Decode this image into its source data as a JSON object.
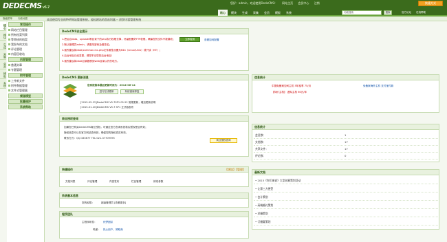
{
  "header": {
    "logo_text": "DEDECMS",
    "logo_version": "v5.7",
    "top_links": [
      "您好：admin，欢迎使用DedeCMS！",
      "网站主页",
      "会员中心",
      "注销"
    ],
    "shortcut_label": "快捷方式",
    "nav": [
      "核心",
      "模块",
      "生成",
      "采集",
      "会员",
      "模板",
      "系统"
    ],
    "nav_active": "核心",
    "search_placeholder": "功能搜索",
    "search_button": "搜索",
    "right_links": [
      "官方论坛",
      "在线帮助"
    ]
  },
  "subbar": {
    "left": "隐藏菜单",
    "middle": "功能地图"
  },
  "welcome_text": "欢迎使用专业的PHP网站管理系统，轻松建站的首选利器 -- 织梦内容管理系统",
  "vtabs": [
    "核心",
    "模块",
    "生成",
    "采集",
    "会员",
    "模板",
    "系统"
  ],
  "sidebar": {
    "sections": [
      {
        "title": "常用操作",
        "items": [
          "网站栏目管理",
          "所有档案列表",
          "等审核的档案",
          "我发布的文档",
          "评论管理",
          "内容回收站"
        ]
      },
      {
        "title": "内容管理",
        "items": [
          "普通文章",
          "专题管理"
        ]
      },
      {
        "title": "附件管理",
        "items": [
          "上传新文件",
          "附件数据管理",
          "文件式管理器"
        ]
      },
      {
        "title": "频道模型",
        "items": []
      },
      {
        "title": "批量维护",
        "items": []
      },
      {
        "title": "系统帮助",
        "items": []
      }
    ]
  },
  "security": {
    "title": "DedeCMS安全提示",
    "lines": [
      "1.把后台data、uploads等目录下的php执行权限去掉，尽量配置好FTP权限，确保您的文件不被篡改；",
      "2.默认管理员admin，请更改密码及登录名；",
      "3.强烈建议将data/common.inc.php文件属性设置为644（Linux/Unix）或只读（NT）；",
      "4.后台地址已经变更，请您牢记您的后台地址！",
      "5.强烈建议将data目录搬移到web目录以外的地方。"
    ],
    "button": "立即检测",
    "link": "查看如何配置"
  },
  "update": {
    "title": "DedeCMS 更新消息",
    "version_text": "您系统版本最后更新时间为：2014-06-14",
    "btn_check": "进行在线更新",
    "btn_log": "系统错误修复",
    "news_lines": [
      "[2015-05-22]DedeCMS V5.7SP1 05-22 常规更新，增加更新说明",
      "[2015-01-20]DedeCMS V5.7 SP1 正式版发布"
    ]
  },
  "commercial": {
    "title": "商业授权查询",
    "lines": [
      "如果您已购买DedeCMS商业授权，可通过官方查询系统核实授权是否有效；",
      "授权信息可以在官方网站查询到，确保您的授权真实有效。",
      "联系方式：QQ:163677 TEL:021-37709595"
    ],
    "button": "商业授权查询"
  },
  "shortcut": {
    "title": "快捷操作",
    "right": "【增加】【管理】",
    "items": [
      "文档列表",
      "评论管理",
      "内容发布",
      "栏目管理",
      "修改系统参数",
      "修改参数"
    ]
  },
  "sysinfo": {
    "title": "系统基本信息",
    "label": "您的权限：",
    "value": "超级管理员 [查看更多]"
  },
  "team": {
    "title": "程序团队",
    "rows": [
      {
        "label": "主程序研发：",
        "value": "织梦团队"
      },
      {
        "label": "鸣谢：",
        "value": "热心用户、赞助商"
      }
    ]
  },
  "messages": {
    "title": "信息统计",
    "ad_row1_left": "中国免备案空间主机 5年独享 75/月",
    "ad_row1_right": "免备案海外主机 支付宝付款",
    "ad_row2_left": "【特价主机】 虚拟主机 60元/年"
  },
  "stats": {
    "title": "信息统计",
    "rows": [
      {
        "label": "会员数：",
        "value": "1"
      },
      {
        "label": "文档数：",
        "value": "17"
      },
      {
        "label": "共享文件：",
        "value": "17"
      },
      {
        "label": "评论数：",
        "value": "0"
      }
    ]
  },
  "docs": {
    "title": "最新文档",
    "items": [
      "2015《你们来说》大型创意策划活动",
      "让第三方更受",
      "会计策划",
      "高端婚礼策划",
      "求婚策划",
      "订婚宴策划"
    ]
  },
  "colors": {
    "header": "#3b6b1c",
    "accent": "#6aa53d",
    "panel_head": "#e8f1de",
    "shortcut": "#f3a221"
  }
}
